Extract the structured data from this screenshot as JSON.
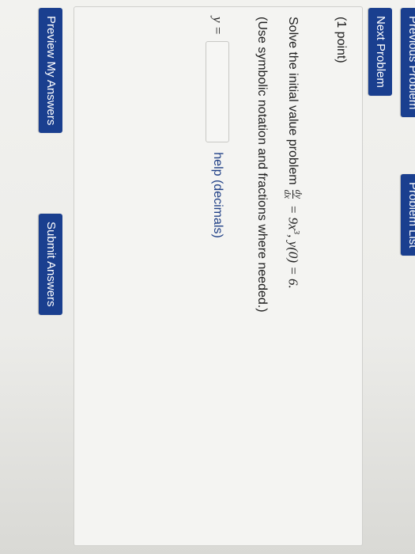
{
  "nav": {
    "previous_label": "Previous Problem",
    "problem_list_label": "Problem List",
    "next_label": "Next Problem"
  },
  "problem": {
    "points": "(1 point)",
    "prompt_prefix": "Solve the initial value problem",
    "frac_num": "dy",
    "frac_den": "dx",
    "equation_rest_a": "= 9x",
    "exponent": "3",
    "equation_rest_b": ",  y(0) = 6.",
    "instructions": "(Use symbolic notation and fractions where needed.)",
    "answer_label": "y =",
    "answer_value": "",
    "help_label": "help (decimals)"
  },
  "actions": {
    "preview_label": "Preview My Answers",
    "submit_label": "Submit Answers"
  },
  "colors": {
    "button_bg": "#1a3f8f",
    "link": "#1f3f86"
  }
}
